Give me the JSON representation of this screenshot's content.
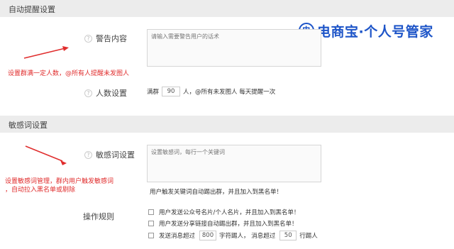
{
  "sections": {
    "auto_remind": {
      "title": "自动提醒设置"
    },
    "sensitive": {
      "title": "敏感词设置"
    }
  },
  "brand": {
    "logo_glyph": "电",
    "text": "电商宝·个人号管家",
    "color": "#1e55c8",
    "icon": "brand-logo-icon"
  },
  "auto_remind": {
    "warning_label": "警告内容",
    "warning_placeholder": "请输入需要警告用户的话术",
    "annotation": "设置群满一定人数，@所有人提醒未发图人",
    "count_label": "人数设置",
    "count_prefix": "满群",
    "count_value": "90",
    "count_suffix": "人，@所有未发图人 每天提醒一次"
  },
  "sensitive": {
    "word_label": "敏感词设置",
    "word_placeholder": "设置敏感词，每行一个关键词",
    "annotation_lines": [
      "设置敏感词管理，群内用户触发敏感词",
      "，自动拉入黑名单或剔除"
    ],
    "trigger_note": "用户触发关键词自动踢出群，并且加入到黑名单！",
    "rules_label": "操作规则",
    "rules": {
      "rule1": "用户发送公众号名片/个人名片，并且加入到黑名单！",
      "rule2": "用户发送分享链接自动踢出群，并且加入到黑名单！",
      "rule3_prefix": "发送消息超过",
      "rule3_chars": "800",
      "rule3_mid": "字符踢人，  消息超过",
      "rule3_msgs": "50",
      "rule3_suffix": "行踢人"
    }
  },
  "colors": {
    "annotation_red": "#e02d2d",
    "section_bg": "#ececec"
  }
}
